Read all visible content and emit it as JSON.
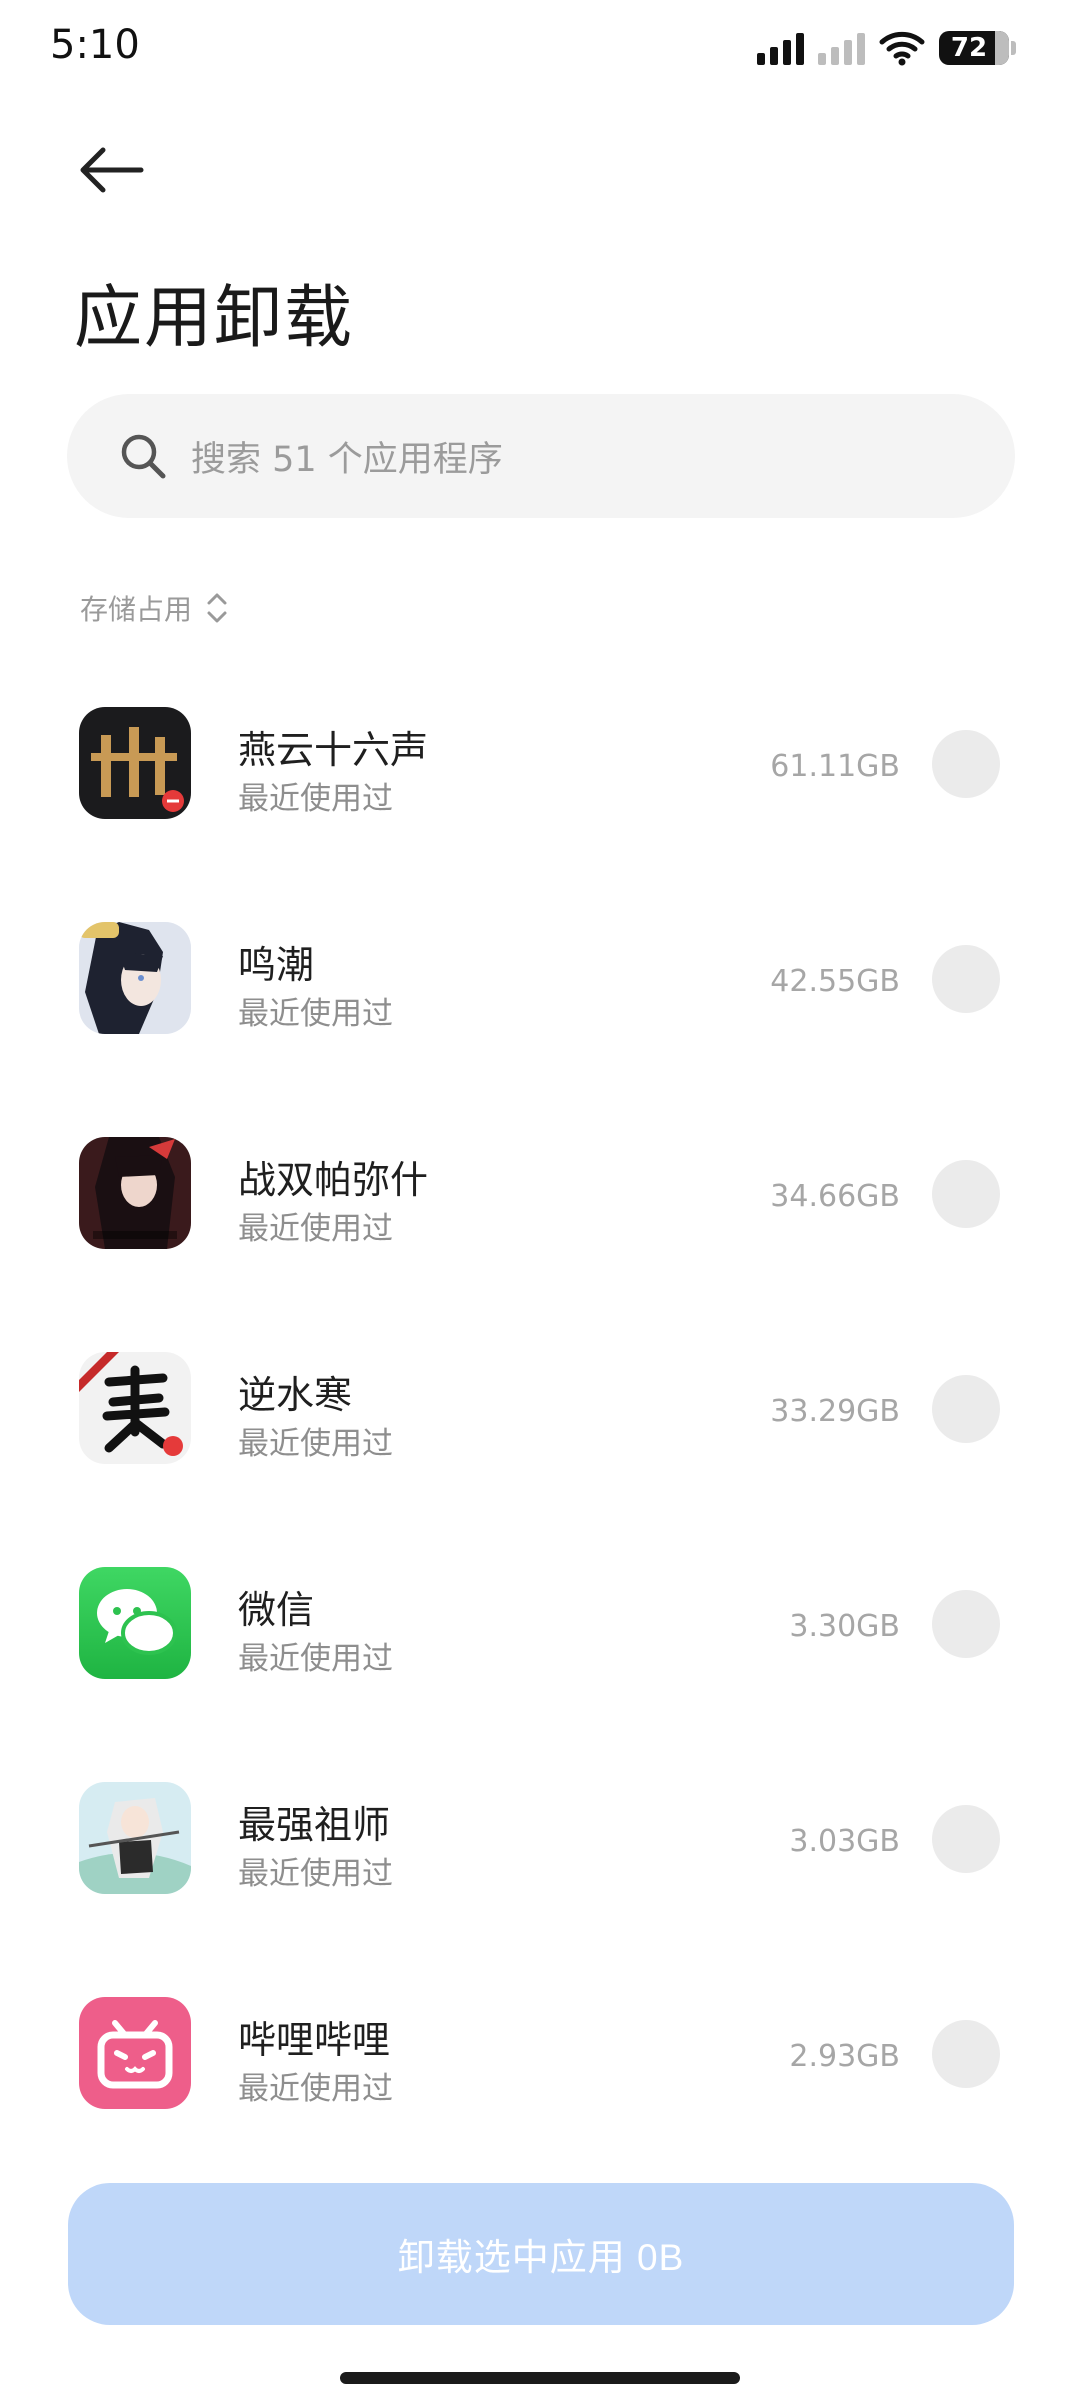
{
  "status_bar": {
    "time": "5:10",
    "battery": "72",
    "icons": [
      "signal-icon",
      "signal-weak-icon",
      "wifi-icon",
      "battery-icon"
    ]
  },
  "header": {
    "back_icon": "arrow-left-icon",
    "title": "应用卸载"
  },
  "search": {
    "placeholder": "搜索 51 个应用程序",
    "icon": "search-icon"
  },
  "sort": {
    "label": "存储占用",
    "icon": "sort-chevrons-icon"
  },
  "apps": [
    {
      "name": "燕云十六声",
      "subtitle": "最近使用过",
      "size": "61.11GB",
      "icon": "yanyun-app-icon",
      "selected": false
    },
    {
      "name": "鸣潮",
      "subtitle": "最近使用过",
      "size": "42.55GB",
      "icon": "wuthering-waves-app-icon",
      "selected": false
    },
    {
      "name": "战双帕弥什",
      "subtitle": "最近使用过",
      "size": "34.66GB",
      "icon": "punishing-app-icon",
      "selected": false
    },
    {
      "name": "逆水寒",
      "subtitle": "最近使用过",
      "size": "33.29GB",
      "icon": "nishuihan-app-icon",
      "selected": false
    },
    {
      "name": "微信",
      "subtitle": "最近使用过",
      "size": "3.30GB",
      "icon": "wechat-app-icon",
      "selected": false
    },
    {
      "name": "最强祖师",
      "subtitle": "最近使用过",
      "size": "3.03GB",
      "icon": "zuishi-app-icon",
      "selected": false
    },
    {
      "name": "哔哩哔哩",
      "subtitle": "最近使用过",
      "size": "2.93GB",
      "icon": "bilibili-app-icon",
      "selected": false
    }
  ],
  "footer": {
    "uninstall_label": "卸载选中应用 0B"
  },
  "colors": {
    "accent_disabled": "#bfd7f9",
    "search_bg": "#f4f4f4",
    "checkbox_bg": "#ebebeb",
    "wechat_green": "#2dc24f",
    "bilibili_pink": "#ee5e8a"
  }
}
